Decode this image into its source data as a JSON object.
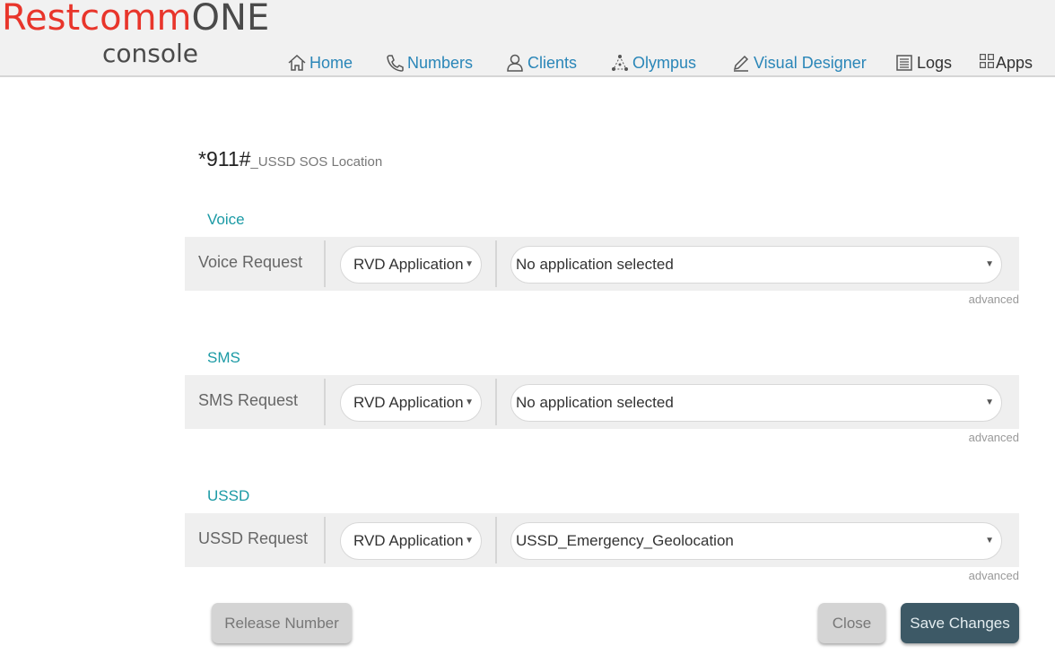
{
  "brand": {
    "logo_red": "Restcomm",
    "logo_gray": "ONE",
    "sub": "console"
  },
  "nav": {
    "home": "Home",
    "numbers": "Numbers",
    "clients": "Clients",
    "olympus": "Olympus",
    "visual_designer": "Visual Designer",
    "logs": "Logs",
    "apps": "Apps"
  },
  "number": {
    "value": "*911#",
    "friendly_name": "_USSD SOS Location"
  },
  "sections": {
    "voice": {
      "heading": "Voice",
      "label": "Voice Request",
      "type_value": "RVD Application",
      "app_value": "No application selected",
      "advanced": "advanced"
    },
    "sms": {
      "heading": "SMS",
      "label": "SMS Request",
      "type_value": "RVD Application",
      "app_value": "No application selected",
      "advanced": "advanced"
    },
    "ussd": {
      "heading": "USSD",
      "label": "USSD Request",
      "type_value": "RVD Application",
      "app_value": "USSD_Emergency_Geolocation",
      "advanced": "advanced"
    }
  },
  "buttons": {
    "release": "Release Number",
    "close": "Close",
    "save": "Save Changes"
  },
  "colors": {
    "brand_red": "#e8352b",
    "link_blue": "#2a86b8",
    "section_teal": "#1b9aa5",
    "save_bg": "#3d5966"
  }
}
